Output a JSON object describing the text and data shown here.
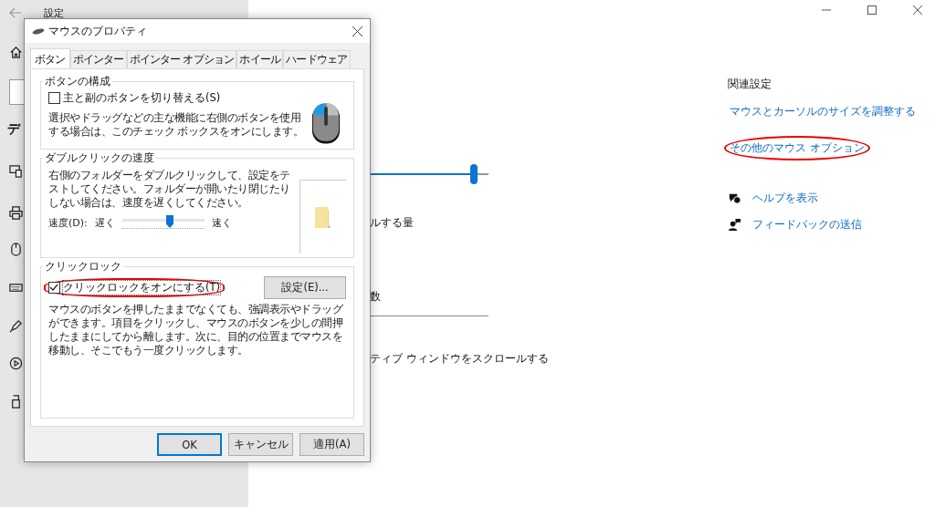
{
  "settings": {
    "title": "設定",
    "sidebar_heading": "デ",
    "content": {
      "slider": {
        "level": 0.88
      },
      "texts": [
        "ルする量",
        "数",
        "ティブ ウィンドウをスクロールする"
      ]
    },
    "related": {
      "heading": "関連設定",
      "links": [
        {
          "label": "マウスとカーソルのサイズを調整する",
          "highlighted": false
        },
        {
          "label": "その他のマウス オプション",
          "highlighted": true
        }
      ],
      "help": [
        {
          "kind": "help",
          "label": "ヘルプを表示"
        },
        {
          "kind": "feedback",
          "label": "フィードバックの送信"
        }
      ]
    }
  },
  "dialog": {
    "title": "マウスのプロパティ",
    "tabs": [
      {
        "label": "ボタン",
        "selected": true
      },
      {
        "label": "ポインター",
        "selected": false
      },
      {
        "label": "ポインター オプション",
        "selected": false
      },
      {
        "label": "ホイール",
        "selected": false
      },
      {
        "label": "ハードウェア",
        "selected": false
      }
    ],
    "button_config": {
      "legend": "ボタンの構成",
      "checkbox": {
        "label": "主と副のボタンを切り替える(S)",
        "checked": false,
        "highlighted": false
      },
      "description": "選択やドラッグなどの主な機能に右側のボタンを使用する場合は、このチェック ボックスをオンにします。"
    },
    "double_click": {
      "legend": "ダブルクリックの速度",
      "description": "右側のフォルダーをダブルクリックして、設定をテストしてください。フォルダーが開いたり閉じたりしない場合は、速度を遅くしてください。",
      "speed_label": "速度(D):",
      "slow": "遅く",
      "fast": "速く",
      "level": 0.58
    },
    "click_lock": {
      "legend": "クリックロック",
      "checkbox": {
        "label": "クリックロックをオンにする(T)",
        "checked": true,
        "highlighted": true
      },
      "settings_button": "設定(E)...",
      "description": "マウスのボタンを押したままでなくても、強調表示やドラッグができます。項目をクリックし、マウスのボタンを少しの間押したままにしてから離します。次に、目的の位置までマウスを移動し、そこでもう一度クリックします。"
    },
    "buttons": [
      {
        "label": "OK",
        "default": true
      },
      {
        "label": "キャンセル",
        "default": false
      },
      {
        "label": "適用(A)",
        "default": false
      }
    ]
  }
}
